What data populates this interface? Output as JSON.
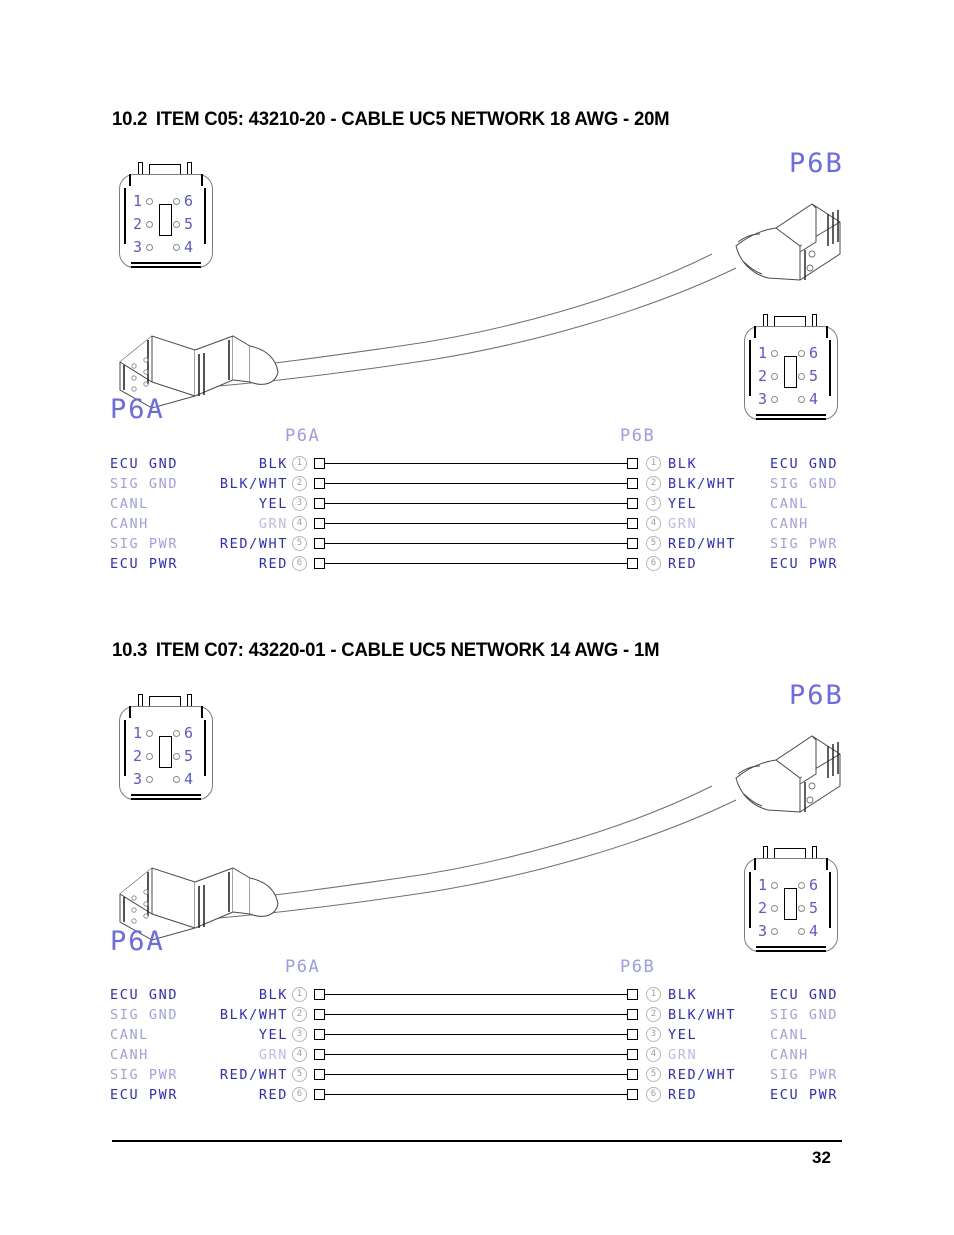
{
  "document": {
    "page_number": "32"
  },
  "sections": [
    {
      "number": "10.2",
      "title": "ITEM C05: 43210-20 - CABLE UC5 NETWORK 18 AWG - 20M",
      "connector_a_label": "P6A",
      "connector_b_label": "P6B",
      "face_top_label": "P6B",
      "table": {
        "header_left": "P6A",
        "header_right": "P6B",
        "rows": [
          {
            "pin": "1",
            "color": "BLK",
            "function": "ECU GND"
          },
          {
            "pin": "2",
            "color": "BLK/WHT",
            "function": "SIG GND"
          },
          {
            "pin": "3",
            "color": "YEL",
            "function": "CANL"
          },
          {
            "pin": "4",
            "color": "GRN",
            "function": "CANH"
          },
          {
            "pin": "5",
            "color": "RED/WHT",
            "function": "SIG PWR"
          },
          {
            "pin": "6",
            "color": "RED",
            "function": "ECU PWR"
          }
        ]
      },
      "face_pins": {
        "left_column": [
          "1",
          "2",
          "3"
        ],
        "right_column": [
          "6",
          "5",
          "4"
        ]
      }
    },
    {
      "number": "10.3",
      "title": "ITEM C07: 43220-01 - CABLE UC5 NETWORK 14 AWG - 1M",
      "connector_a_label": "P6A",
      "connector_b_label": "P6B",
      "face_top_label": "P6B",
      "table": {
        "header_left": "P6A",
        "header_right": "P6B",
        "rows": [
          {
            "pin": "1",
            "color": "BLK",
            "function": "ECU GND"
          },
          {
            "pin": "2",
            "color": "BLK/WHT",
            "function": "SIG GND"
          },
          {
            "pin": "3",
            "color": "YEL",
            "function": "CANL"
          },
          {
            "pin": "4",
            "color": "GRN",
            "function": "CANH"
          },
          {
            "pin": "5",
            "color": "RED/WHT",
            "function": "SIG PWR"
          },
          {
            "pin": "6",
            "color": "RED",
            "function": "ECU PWR"
          }
        ]
      },
      "face_pins": {
        "left_column": [
          "1",
          "2",
          "3"
        ],
        "right_column": [
          "6",
          "5",
          "4"
        ]
      }
    }
  ],
  "colors": {
    "text_blue": "#2b2bd4",
    "text_blue_dim": "#9e9eea",
    "label_blue": "#6a6af0",
    "wire_black": "#000000"
  }
}
